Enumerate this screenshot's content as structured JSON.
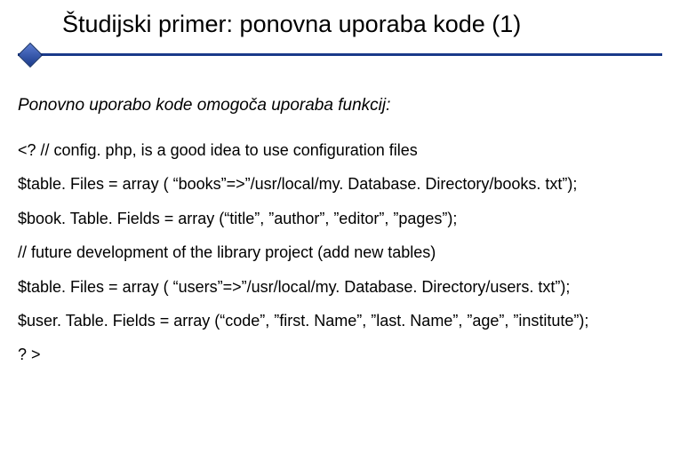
{
  "title": "Študijski primer: ponovna uporaba kode (1)",
  "intro": "Ponovno uporabo kode omogoča uporaba funkcij:",
  "code": {
    "l1": "<? // config. php, is a good idea to use configuration files",
    "l2": "$table. Files = array ( “books”=>”/usr/local/my. Database. Directory/books. txt”);",
    "l3": "$book. Table. Fields = array (“title”, ”author”, ”editor”, ”pages”);",
    "l4": "// future development of the library project (add new tables)",
    "l5": "$table. Files = array ( “users”=>”/usr/local/my. Database. Directory/users. txt”);",
    "l6": "$user. Table. Fields = array (“code”, ”first. Name”, ”last. Name”, ”age”, ”institute”);",
    "l7": "? >"
  }
}
